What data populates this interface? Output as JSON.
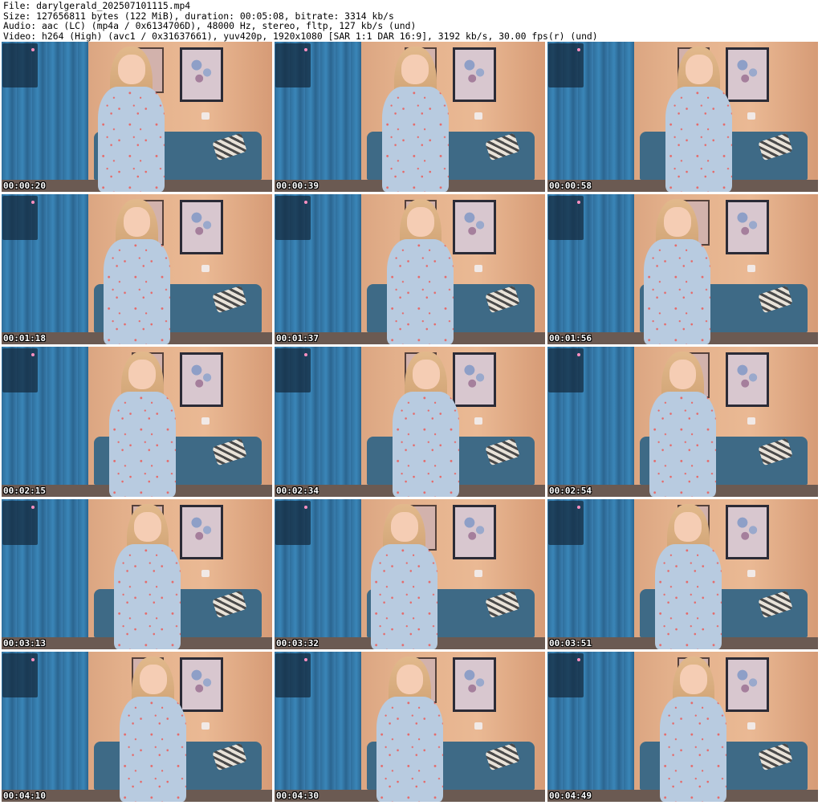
{
  "header": {
    "file": "File: darylgerald_202507101115.mp4",
    "size": "Size: 127656811 bytes (122 MiB), duration: 00:05:08, bitrate: 3314 kb/s",
    "audio": "Audio: aac (LC) (mp4a / 0x6134706D), 48000 Hz, stereo, fltp, 127 kb/s (und)",
    "video": "Video: h264 (High) (avc1 / 0x31637661), yuv420p, 1920x1080 [SAR 1:1 DAR 16:9], 3192 kb/s, 30.00 fps(r) (und)"
  },
  "thumbnails": [
    {
      "timestamp": "00:00:20"
    },
    {
      "timestamp": "00:00:39"
    },
    {
      "timestamp": "00:00:58"
    },
    {
      "timestamp": "00:01:18"
    },
    {
      "timestamp": "00:01:37"
    },
    {
      "timestamp": "00:01:56"
    },
    {
      "timestamp": "00:02:15"
    },
    {
      "timestamp": "00:02:34"
    },
    {
      "timestamp": "00:02:54"
    },
    {
      "timestamp": "00:03:13"
    },
    {
      "timestamp": "00:03:32"
    },
    {
      "timestamp": "00:03:51"
    },
    {
      "timestamp": "00:04:10"
    },
    {
      "timestamp": "00:04:30"
    },
    {
      "timestamp": "00:04:49"
    }
  ],
  "colors": {
    "background": "#ffffff",
    "timestamp_text": "#ffffff",
    "curtain": "#3a86b8",
    "wall": "#e3b08b",
    "dress": "#b8cbe0"
  }
}
